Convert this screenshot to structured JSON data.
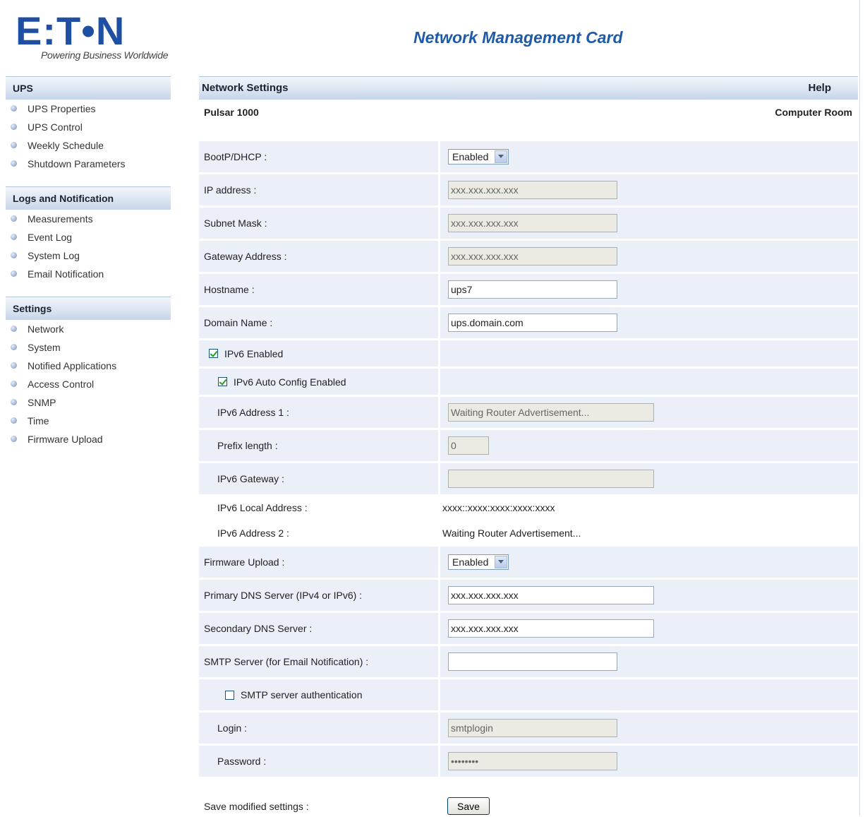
{
  "brand": {
    "logo_text": "E:T•N",
    "tagline": "Powering Business Worldwide",
    "primary_color": "#1f4fa3"
  },
  "app_title": "Network Management Card",
  "sidebar": {
    "sections": [
      {
        "title": "UPS",
        "items": [
          "UPS Properties",
          "UPS Control",
          "Weekly Schedule",
          "Shutdown Parameters"
        ]
      },
      {
        "title": "Logs and Notification",
        "items": [
          "Measurements",
          "Event Log",
          "System Log",
          "Email Notification"
        ]
      },
      {
        "title": "Settings",
        "items": [
          "Network",
          "System",
          "Notified Applications",
          "Access Control",
          "SNMP",
          "Time",
          "Firmware Upload"
        ]
      }
    ]
  },
  "main": {
    "header": "Network Settings",
    "help": "Help",
    "device": "Pulsar 1000",
    "location": "Computer Room",
    "bootp": {
      "label": "BootP/DHCP :",
      "value": "Enabled"
    },
    "ip": {
      "label": "IP address :",
      "value": "xxx.xxx.xxx.xxx"
    },
    "subnet": {
      "label": "Subnet Mask :",
      "value": "xxx.xxx.xxx.xxx"
    },
    "gateway": {
      "label": "Gateway Address :",
      "value": "xxx.xxx.xxx.xxx"
    },
    "hostname": {
      "label": "Hostname :",
      "value": "ups7"
    },
    "domain": {
      "label": "Domain Name :",
      "value": "ups.domain.com"
    },
    "ipv6_enabled": {
      "label": "IPv6 Enabled",
      "checked": true
    },
    "ipv6_auto": {
      "label": "IPv6 Auto Config Enabled",
      "checked": true
    },
    "ipv6_addr1": {
      "label": "IPv6 Address 1 :",
      "value": "Waiting Router Advertisement..."
    },
    "prefix": {
      "label": "Prefix length :",
      "value": "0"
    },
    "ipv6_gw": {
      "label": "IPv6 Gateway :",
      "value": ""
    },
    "ipv6_local": {
      "label": "IPv6 Local Address :",
      "value": "xxxx::xxxx:xxxx:xxxx:xxxx"
    },
    "ipv6_addr2": {
      "label": "IPv6 Address 2 :",
      "value": "Waiting Router Advertisement..."
    },
    "fw_upload": {
      "label": "Firmware Upload :",
      "value": "Enabled"
    },
    "dns1": {
      "label": "Primary DNS Server (IPv4 or IPv6) :",
      "value": "xxx.xxx.xxx.xxx"
    },
    "dns2": {
      "label": "Secondary DNS Server :",
      "value": "xxx.xxx.xxx.xxx"
    },
    "smtp": {
      "label": "SMTP Server (for Email Notification) :",
      "value": ""
    },
    "smtp_auth": {
      "label": "SMTP server authentication",
      "checked": false
    },
    "login": {
      "label": "Login :",
      "value": "smtplogin"
    },
    "password": {
      "label": "Password :",
      "value": "••••••••"
    },
    "save": {
      "label": "Save modified settings :",
      "button": "Save"
    }
  }
}
